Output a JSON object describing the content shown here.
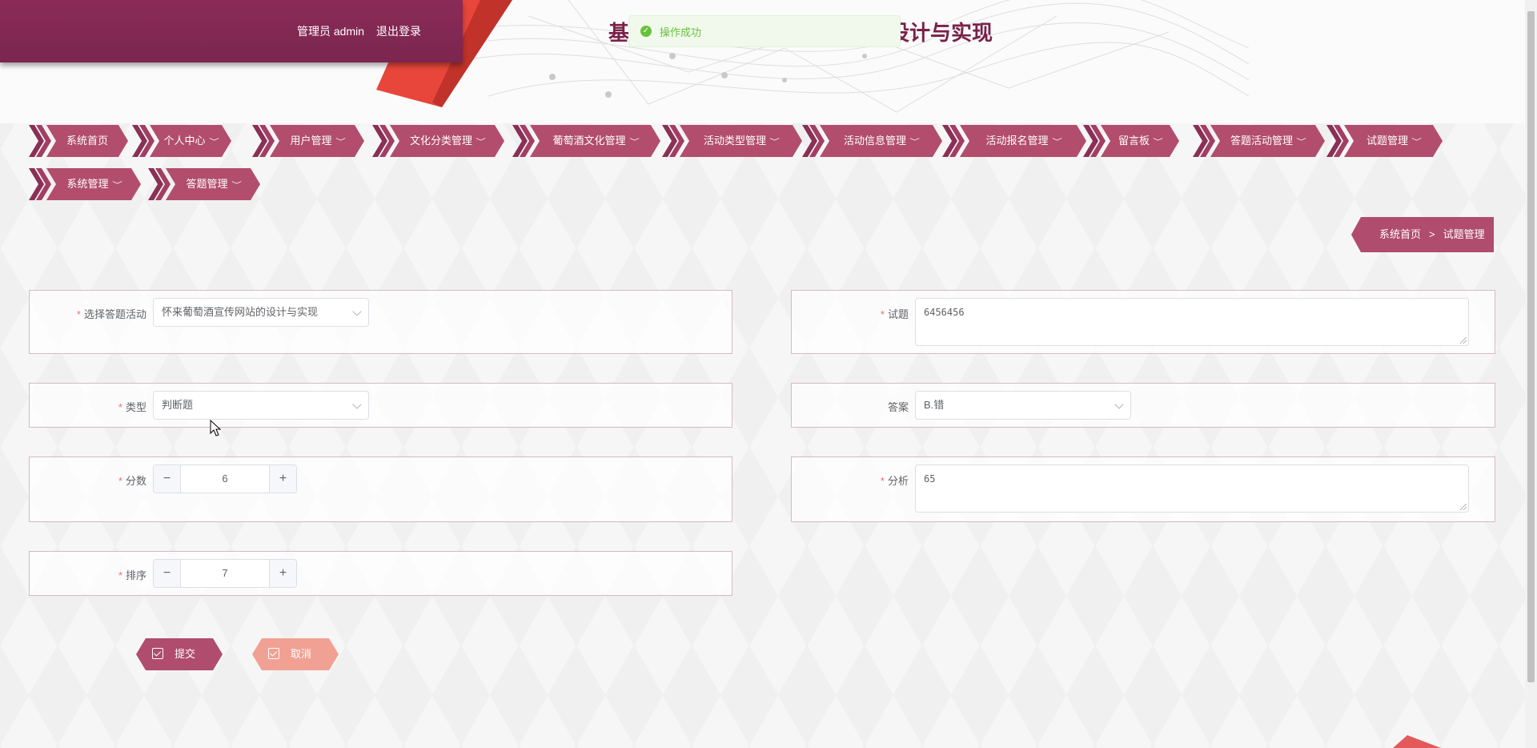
{
  "header": {
    "user": "管理员 admin",
    "logout": "退出登录",
    "title": "基于Web的葡萄酒宣传网站的设计与实现",
    "toast": "操作成功"
  },
  "nav": {
    "items": [
      {
        "label": "系统首页",
        "dropdown": false
      },
      {
        "label": "个人中心",
        "dropdown": true
      },
      {
        "label": "用户管理",
        "dropdown": true
      },
      {
        "label": "文化分类管理",
        "dropdown": true
      },
      {
        "label": "葡萄酒文化管理",
        "dropdown": true
      },
      {
        "label": "活动类型管理",
        "dropdown": true
      },
      {
        "label": "活动信息管理",
        "dropdown": true
      },
      {
        "label": "活动报名管理",
        "dropdown": true
      },
      {
        "label": "留言板",
        "dropdown": true
      },
      {
        "label": "答题活动管理",
        "dropdown": true
      },
      {
        "label": "试题管理",
        "dropdown": true
      },
      {
        "label": "系统管理",
        "dropdown": true
      },
      {
        "label": "答题管理",
        "dropdown": true
      }
    ]
  },
  "breadcrumb": {
    "home": "系统首页",
    "separator": ">",
    "current": "试题管理"
  },
  "form": {
    "activity": {
      "label": "选择答题活动",
      "value": "怀来葡萄酒宣传网站的设计与实现"
    },
    "question": {
      "label": "试题",
      "value": "6456456"
    },
    "type": {
      "label": "类型",
      "value": "判断题"
    },
    "answer": {
      "label": "答案",
      "value": "B.错"
    },
    "score": {
      "label": "分数",
      "value": "6"
    },
    "analysis": {
      "label": "分析",
      "value": "65"
    },
    "order": {
      "label": "排序",
      "value": "7"
    },
    "required_mark": "*",
    "minus": "−",
    "plus": "+"
  },
  "actions": {
    "submit": "提交",
    "cancel": "取消"
  },
  "colors": {
    "primary": "#b04c6d",
    "dark": "#7b2650",
    "cancel": "#f1a194",
    "success": "#67c23a"
  }
}
